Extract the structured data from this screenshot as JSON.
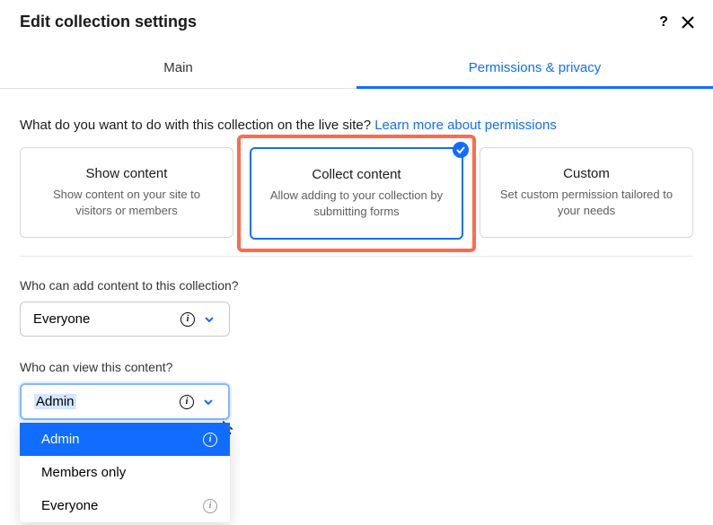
{
  "header": {
    "title": "Edit collection settings"
  },
  "tabs": {
    "main": "Main",
    "permissions": "Permissions & privacy"
  },
  "prompt": {
    "text": "What do you want to do with this collection on the live site? ",
    "link": "Learn more about permissions"
  },
  "cards": {
    "show": {
      "title": "Show content",
      "desc": "Show content on your site to visitors or members"
    },
    "collect": {
      "title": "Collect content",
      "desc": "Allow adding to your collection by submitting forms"
    },
    "custom": {
      "title": "Custom",
      "desc": "Set custom permission tailored to your needs"
    }
  },
  "fields": {
    "add": {
      "label": "Who can add content to this collection?",
      "value": "Everyone"
    },
    "view": {
      "label": "Who can view this content?",
      "value": "Admin"
    }
  },
  "view_options": {
    "admin": "Admin",
    "members": "Members only",
    "everyone": "Everyone"
  }
}
